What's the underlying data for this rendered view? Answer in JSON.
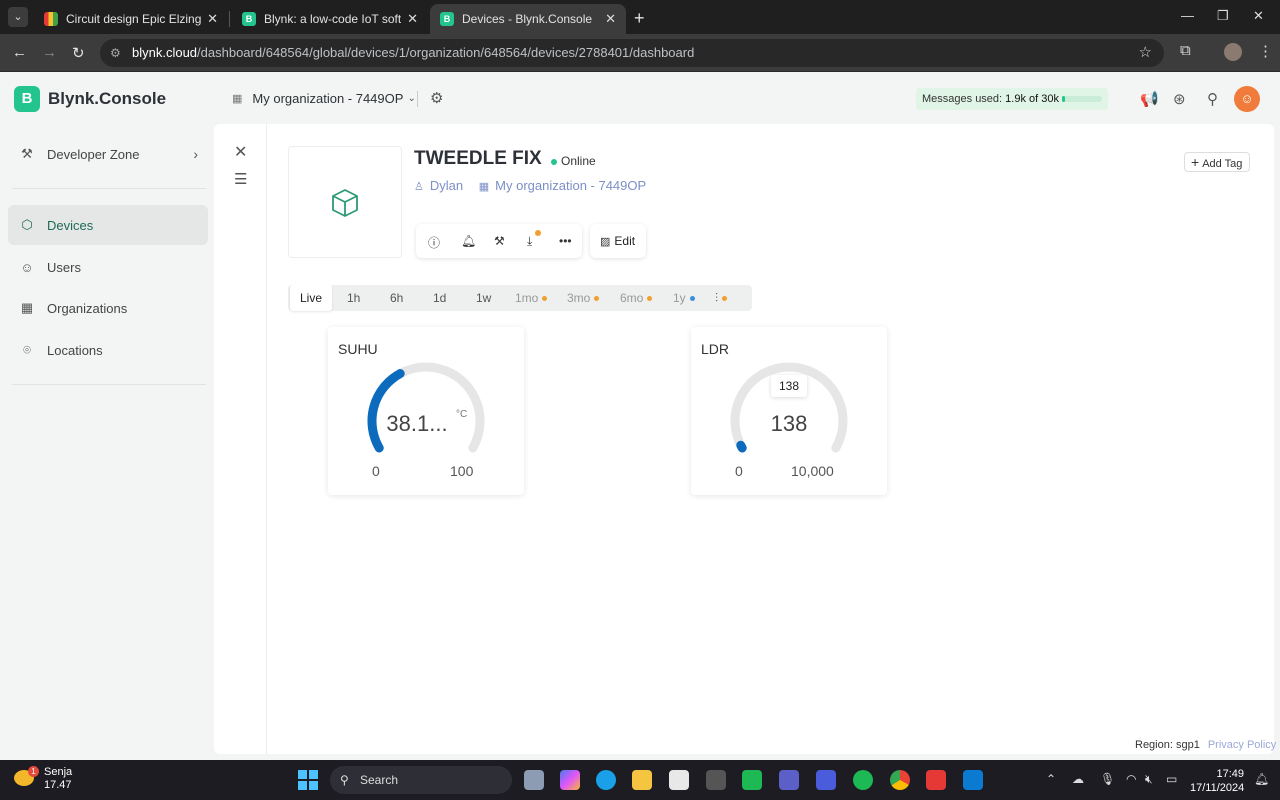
{
  "browser": {
    "tabs": [
      {
        "title": "Circuit design Epic Elzing-Leelo",
        "active": false
      },
      {
        "title": "Blynk: a low-code IoT software p",
        "active": false
      },
      {
        "title": "Devices - Blynk.Console",
        "active": true
      }
    ],
    "url_host": "blynk.cloud",
    "url_path": "/dashboard/648564/global/devices/1/organization/648564/devices/2788401/dashboard"
  },
  "app": {
    "logo_text": "Blynk.Console",
    "logo_letter": "B",
    "sidebar": [
      {
        "label": "Developer Zone",
        "icon": "tools-icon"
      },
      {
        "label": "Devices",
        "icon": "cube-icon",
        "active": true
      },
      {
        "label": "Users",
        "icon": "users-icon"
      },
      {
        "label": "Organizations",
        "icon": "building-icon"
      },
      {
        "label": "Locations",
        "icon": "pin-icon"
      }
    ],
    "org_selector": "My organization - 7449OP",
    "messages": {
      "prefix": "Messages used:",
      "value": "1.9k of 30k",
      "fraction": 0.063
    },
    "avatar_letter": "☺"
  },
  "device": {
    "name": "TWEEDLE FIX",
    "status": "Online",
    "owner": "Dylan",
    "organization": "My organization - 7449OP",
    "edit_label": "Edit",
    "add_tag_label": "Add Tag"
  },
  "time_ranges": [
    {
      "label": "Live",
      "active": true
    },
    {
      "label": "1h"
    },
    {
      "label": "6h"
    },
    {
      "label": "1d"
    },
    {
      "label": "1w"
    },
    {
      "label": "1mo",
      "dot": "#f0a030",
      "muted": true
    },
    {
      "label": "3mo",
      "dot": "#f0a030",
      "muted": true
    },
    {
      "label": "6mo",
      "dot": "#f0a030",
      "muted": true
    },
    {
      "label": "1y",
      "dot": "#3b8fe0",
      "muted": true
    }
  ],
  "widgets": [
    {
      "title": "SUHU",
      "value": "38.1...",
      "unit": "°C",
      "min": "0",
      "max": "100",
      "fraction": 0.381
    },
    {
      "title": "LDR",
      "value": "138",
      "tooltip": "138",
      "min": "0",
      "max": "10,000",
      "fraction": 0.0138
    }
  ],
  "footer": {
    "region": "Region: sgp1",
    "privacy": "Privacy Policy"
  },
  "taskbar": {
    "weather_label": "Senja",
    "weather_value": "17.47",
    "badge": "1",
    "search_label": "Search",
    "time": "17:49",
    "date": "17/11/2024"
  },
  "colors": {
    "accent": "#23c48e",
    "gauge_fill": "#0d6bbd",
    "gauge_track": "#e6e6e6"
  }
}
